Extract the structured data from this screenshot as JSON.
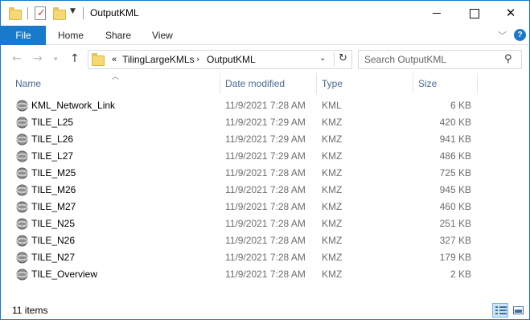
{
  "window": {
    "title": "OutputKML"
  },
  "ribbon": {
    "file_label": "File",
    "tabs": [
      {
        "label": "Home"
      },
      {
        "label": "Share"
      },
      {
        "label": "View"
      }
    ],
    "help_label": "?"
  },
  "address": {
    "overflow_label": "«",
    "crumbs": [
      {
        "label": "TilingLargeKMLs"
      },
      {
        "label": "OutputKML"
      }
    ]
  },
  "search": {
    "placeholder": "Search OutputKML"
  },
  "columns": {
    "name": "Name",
    "date": "Date modified",
    "type": "Type",
    "size": "Size"
  },
  "files": [
    {
      "name": "KML_Network_Link",
      "date": "11/9/2021 7:28 AM",
      "type": "KML",
      "size": "6 KB"
    },
    {
      "name": "TILE_L25",
      "date": "11/9/2021 7:29 AM",
      "type": "KMZ",
      "size": "420 KB"
    },
    {
      "name": "TILE_L26",
      "date": "11/9/2021 7:29 AM",
      "type": "KMZ",
      "size": "941 KB"
    },
    {
      "name": "TILE_L27",
      "date": "11/9/2021 7:29 AM",
      "type": "KMZ",
      "size": "486 KB"
    },
    {
      "name": "TILE_M25",
      "date": "11/9/2021 7:28 AM",
      "type": "KMZ",
      "size": "725 KB"
    },
    {
      "name": "TILE_M26",
      "date": "11/9/2021 7:28 AM",
      "type": "KMZ",
      "size": "945 KB"
    },
    {
      "name": "TILE_M27",
      "date": "11/9/2021 7:28 AM",
      "type": "KMZ",
      "size": "460 KB"
    },
    {
      "name": "TILE_N25",
      "date": "11/9/2021 7:28 AM",
      "type": "KMZ",
      "size": "251 KB"
    },
    {
      "name": "TILE_N26",
      "date": "11/9/2021 7:28 AM",
      "type": "KMZ",
      "size": "327 KB"
    },
    {
      "name": "TILE_N27",
      "date": "11/9/2021 7:28 AM",
      "type": "KMZ",
      "size": "179 KB"
    },
    {
      "name": "TILE_Overview",
      "date": "11/9/2021 7:28 AM",
      "type": "KMZ",
      "size": "2 KB"
    }
  ],
  "status": {
    "item_count": "11 items"
  },
  "colors": {
    "accent": "#1979ca",
    "header_text": "#4a6a90",
    "secondary_text": "#6d6d6d"
  },
  "icons": {
    "file_icon": "globe-icon",
    "folder_icon": "folder-icon"
  }
}
